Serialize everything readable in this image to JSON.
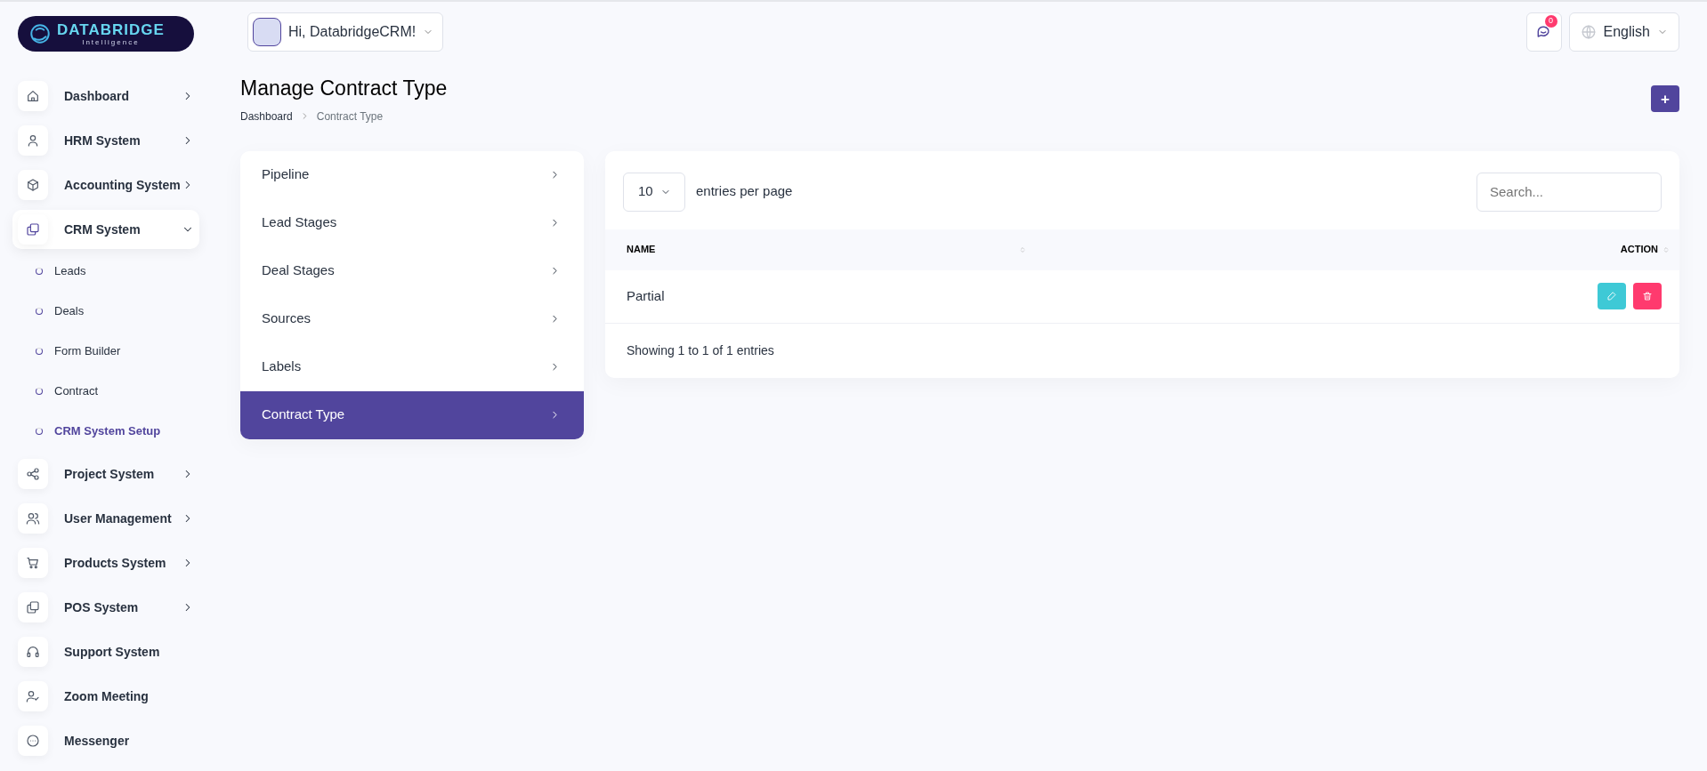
{
  "brand": {
    "name": "DATABRIDGE",
    "tagline": "Intelligence"
  },
  "header": {
    "greeting": "Hi, DatabridgeCRM!",
    "notifications": {
      "count": "0"
    },
    "language": "English"
  },
  "sidebar": {
    "items": [
      {
        "label": "Dashboard",
        "has_submenu": true,
        "expanded": false
      },
      {
        "label": "HRM System",
        "has_submenu": true,
        "expanded": false
      },
      {
        "label": "Accounting System",
        "has_submenu": true,
        "expanded": false
      },
      {
        "label": "CRM System",
        "has_submenu": true,
        "expanded": true,
        "children": [
          {
            "label": "Leads",
            "selected": false
          },
          {
            "label": "Deals",
            "selected": false
          },
          {
            "label": "Form Builder",
            "selected": false
          },
          {
            "label": "Contract",
            "selected": false
          },
          {
            "label": "CRM System Setup",
            "selected": true
          }
        ]
      },
      {
        "label": "Project System",
        "has_submenu": true,
        "expanded": false
      },
      {
        "label": "User Management",
        "has_submenu": true,
        "expanded": false
      },
      {
        "label": "Products System",
        "has_submenu": true,
        "expanded": false
      },
      {
        "label": "POS System",
        "has_submenu": true,
        "expanded": false
      },
      {
        "label": "Support System",
        "has_submenu": false,
        "expanded": false
      },
      {
        "label": "Zoom Meeting",
        "has_submenu": false,
        "expanded": false
      },
      {
        "label": "Messenger",
        "has_submenu": false,
        "expanded": false
      }
    ]
  },
  "page": {
    "title": "Manage Contract Type",
    "breadcrumb": [
      {
        "label": "Dashboard"
      },
      {
        "label": "Contract Type"
      }
    ],
    "add_button": {
      "label": "+"
    }
  },
  "setup_menu": {
    "items": [
      {
        "label": "Pipeline",
        "selected": false
      },
      {
        "label": "Lead Stages",
        "selected": false
      },
      {
        "label": "Deal Stages",
        "selected": false
      },
      {
        "label": "Sources",
        "selected": false
      },
      {
        "label": "Labels",
        "selected": false
      },
      {
        "label": "Contract Type",
        "selected": true
      }
    ]
  },
  "table": {
    "page_size": "10",
    "page_size_label": "entries per page",
    "search": {
      "placeholder": "Search..."
    },
    "columns": [
      {
        "label": "NAME",
        "sortable": true
      },
      {
        "label": "ACTION",
        "sortable": true
      }
    ],
    "rows": [
      {
        "name": "Partial"
      }
    ],
    "footer": "Showing 1 to 1 of 1 entries"
  }
}
